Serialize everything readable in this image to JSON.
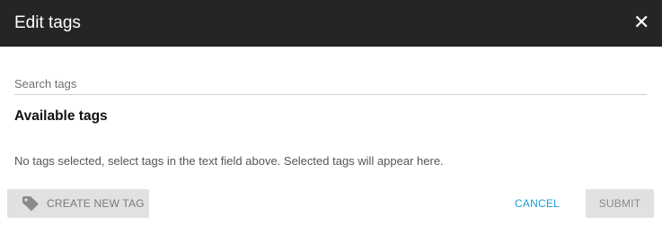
{
  "dialog": {
    "title": "Edit tags",
    "close_icon": "close-icon"
  },
  "search": {
    "value": "",
    "placeholder": "Search tags"
  },
  "available": {
    "heading": "Available tags",
    "empty_message": "No tags selected, select tags in the text field above. Selected tags will appear here."
  },
  "actions": {
    "create_label": "CREATE NEW TAG",
    "create_icon": "tag-icon",
    "cancel_label": "CANCEL",
    "submit_label": "SUBMIT"
  },
  "colors": {
    "header_bg": "#252525",
    "accent": "#1a9bd7",
    "disabled_bg": "#e1e1e1"
  }
}
